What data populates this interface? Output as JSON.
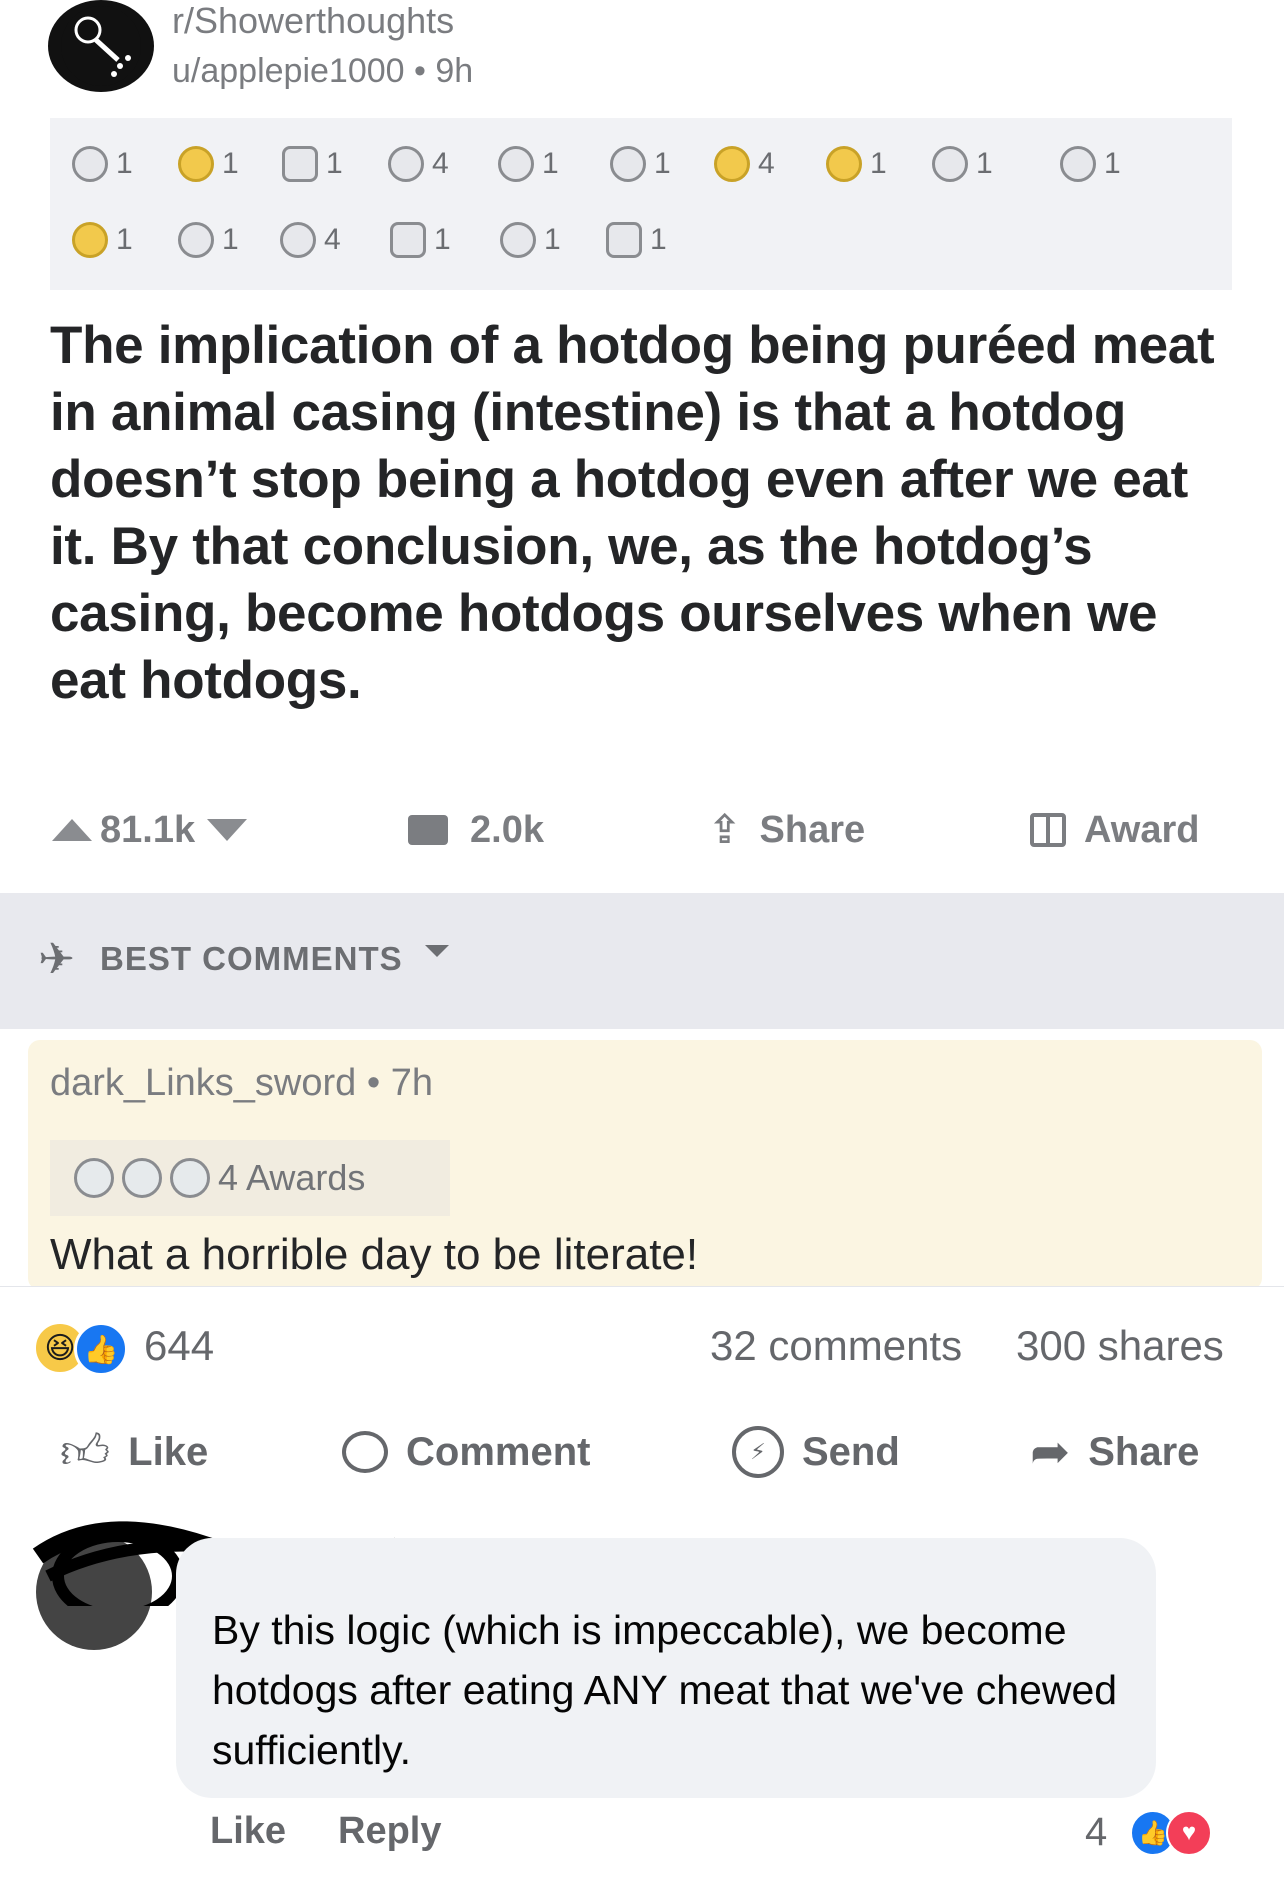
{
  "reddit": {
    "subreddit": "r/Showerthoughts",
    "author": "u/applepie1000",
    "age": "9h",
    "meta_sep": "•",
    "awards_row1": [
      "1",
      "1",
      "1",
      "4",
      "1",
      "1",
      "4",
      "1",
      "1",
      "1"
    ],
    "awards_row2": [
      "1",
      "1",
      "4",
      "1",
      "1",
      "1"
    ],
    "post_text": "The implication of a hotdog being puréed meat in animal casing (intestine) is that a hotdog doesn’t stop being a hotdog even after we eat it. By that conclusion, we, as the hotdog’s casing, become hotdogs ourselves when we eat hotdogs.",
    "score": "81.1k",
    "comments_count": "2.0k",
    "share_label": "Share",
    "award_label": "Award",
    "sort_label": "BEST COMMENTS",
    "top_comment": {
      "user": "dark_Links_sword",
      "age": "7h",
      "awards_label": "4 Awards",
      "text": "What a horrible day to be  literate!"
    }
  },
  "facebook": {
    "reaction_count": "644",
    "comments": "32 comments",
    "shares": "300 shares",
    "actions": {
      "like": "Like",
      "comment": "Comment",
      "send": "Send",
      "share": "Share"
    },
    "reply": {
      "text": "By this logic (which is impeccable), we become hotdogs after eating ANY meat that we've chewed sufficiently.",
      "like_label": "Like",
      "reply_label": "Reply",
      "reaction_count": "4"
    }
  },
  "colors": {
    "fb_blue": "#1877f2",
    "love_red": "#f33e58",
    "reddit_gray": "#7b7d81",
    "comment_bg": "#fbf5e2"
  }
}
